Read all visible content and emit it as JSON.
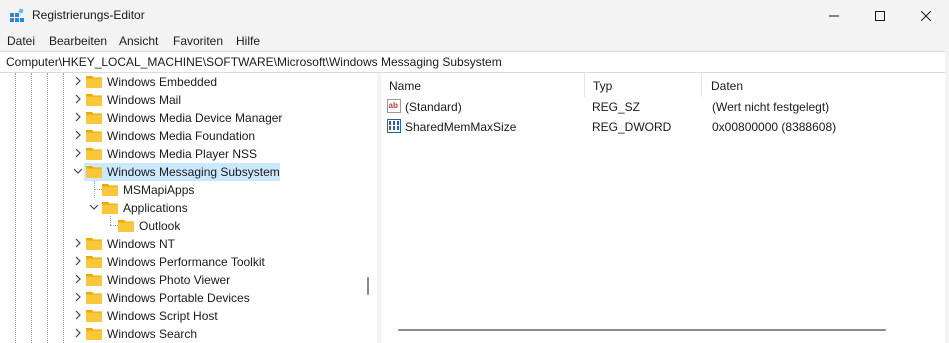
{
  "window": {
    "title": "Registrierungs-Editor"
  },
  "menu": [
    "Datei",
    "Bearbeiten",
    "Ansicht",
    "Favoriten",
    "Hilfe"
  ],
  "address": "Computer\\HKEY_LOCAL_MACHINE\\SOFTWARE\\Microsoft\\Windows Messaging Subsystem",
  "tree": [
    {
      "label": "Windows Embedded",
      "level": 0,
      "expander": "collapsed"
    },
    {
      "label": "Windows Mail",
      "level": 0,
      "expander": "collapsed"
    },
    {
      "label": "Windows Media Device Manager",
      "level": 0,
      "expander": "collapsed"
    },
    {
      "label": "Windows Media Foundation",
      "level": 0,
      "expander": "collapsed"
    },
    {
      "label": "Windows Media Player NSS",
      "level": 0,
      "expander": "collapsed"
    },
    {
      "label": "Windows Messaging Subsystem",
      "level": 0,
      "expander": "expanded",
      "selected": true
    },
    {
      "label": "MSMapiApps",
      "level": 1,
      "expander": "none"
    },
    {
      "label": "Applications",
      "level": 1,
      "expander": "expanded"
    },
    {
      "label": "Outlook",
      "level": 2,
      "expander": "none"
    },
    {
      "label": "Windows NT",
      "level": 0,
      "expander": "collapsed"
    },
    {
      "label": "Windows Performance Toolkit",
      "level": 0,
      "expander": "collapsed"
    },
    {
      "label": "Windows Photo Viewer",
      "level": 0,
      "expander": "collapsed"
    },
    {
      "label": "Windows Portable Devices",
      "level": 0,
      "expander": "collapsed"
    },
    {
      "label": "Windows Script Host",
      "level": 0,
      "expander": "collapsed"
    },
    {
      "label": "Windows Search",
      "level": 0,
      "expander": "collapsed"
    }
  ],
  "columns": {
    "name": "Name",
    "type": "Typ",
    "data": "Daten"
  },
  "values": [
    {
      "icon": "string-value-icon",
      "name": "(Standard)",
      "type": "REG_SZ",
      "data": "(Wert nicht festgelegt)"
    },
    {
      "icon": "binary-value-icon",
      "name": "SharedMemMaxSize",
      "type": "REG_DWORD",
      "data": "0x00800000 (8388608)"
    }
  ],
  "colors": {
    "selection": "#cce8ff",
    "folder": "#f8c73a",
    "accent": "#0067c0"
  }
}
